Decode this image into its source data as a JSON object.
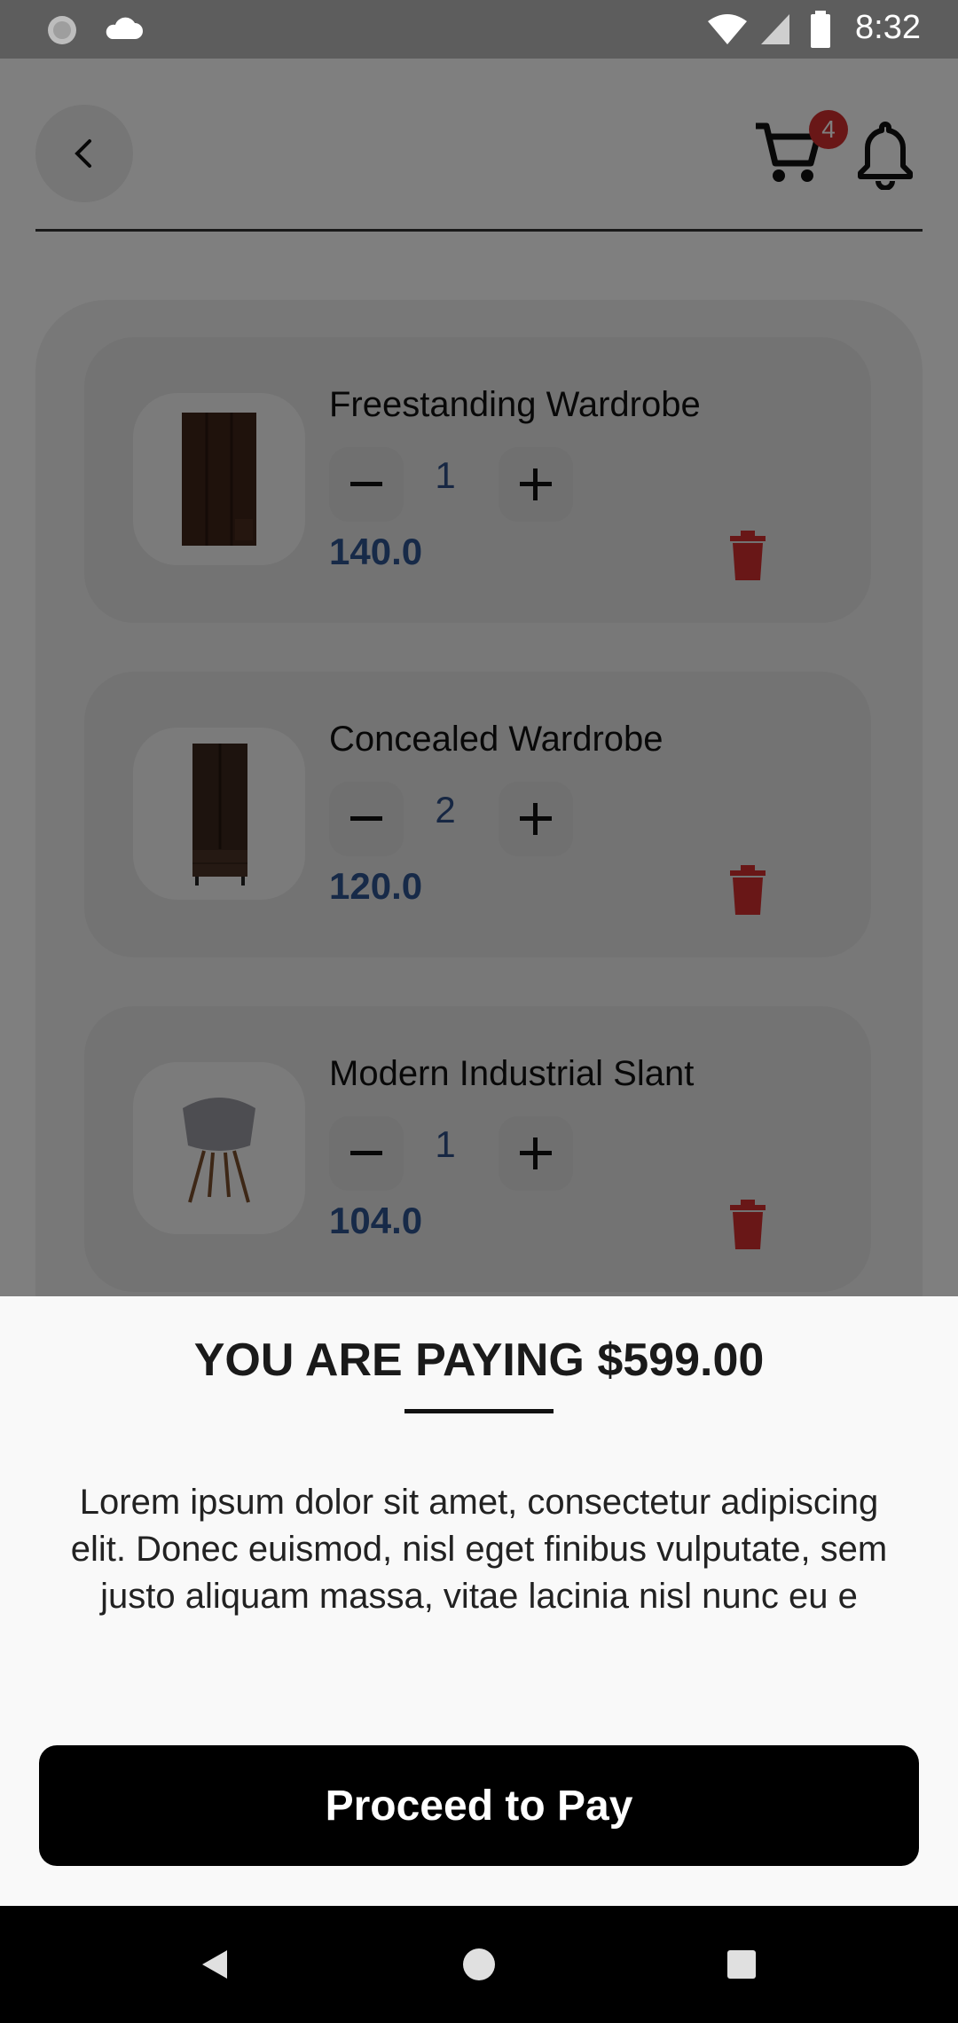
{
  "status_bar": {
    "time": "8:32"
  },
  "header": {
    "cart_count": "4"
  },
  "cart": {
    "items": [
      {
        "name": "Freestanding Wardrobe",
        "quantity": "1",
        "price": "140.0",
        "image": "wardrobe-icon"
      },
      {
        "name": "Concealed Wardrobe",
        "quantity": "2",
        "price": "120.0",
        "image": "wardrobe-icon"
      },
      {
        "name": "Modern Industrial Slant",
        "quantity": "1",
        "price": "104.0",
        "image": "chair-icon"
      }
    ]
  },
  "sheet": {
    "title": "YOU ARE PAYING $599.00",
    "description": "Lorem ipsum dolor sit amet, consectetur adipiscing elit. Donec euismod, nisl eget finibus vulputate, sem justo aliquam massa, vitae lacinia nisl nunc eu e",
    "button_label": "Proceed to Pay"
  },
  "colors": {
    "accent": "#2f5591",
    "danger": "#d32f2f",
    "button": "#000000"
  }
}
